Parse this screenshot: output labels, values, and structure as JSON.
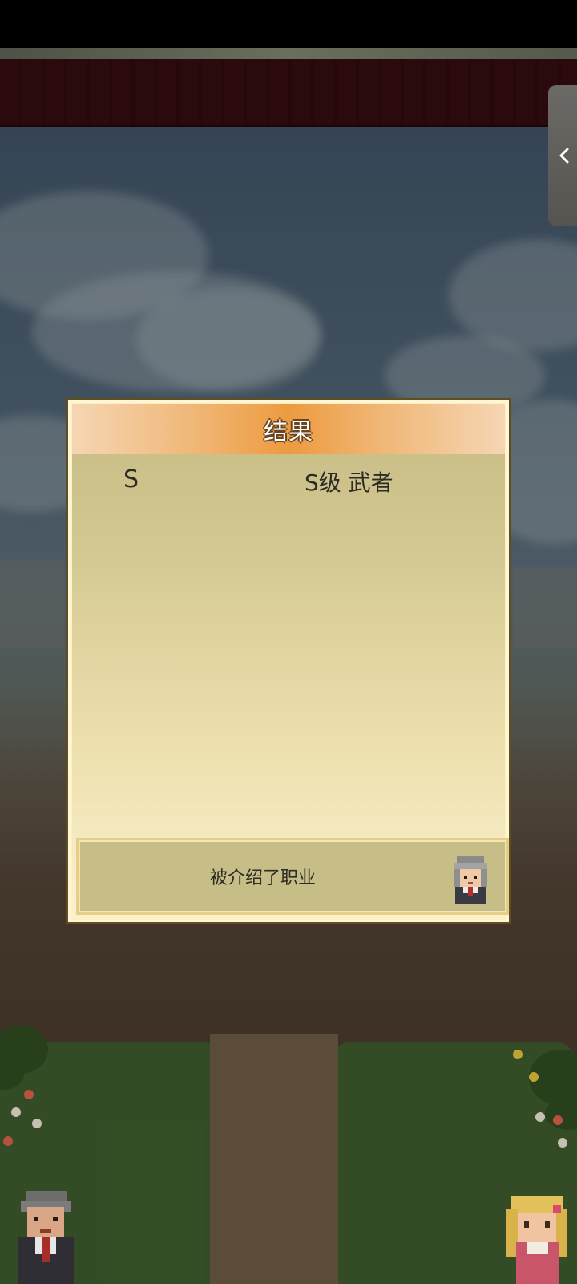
{
  "result_panel": {
    "title": "结果",
    "grade": "S",
    "job": "S级 武者",
    "message": "被介绍了职业"
  },
  "icons": {
    "side_tab": "chevron-left-icon",
    "advisor": "advisor-portrait",
    "villager_left": "elder-villager-sprite",
    "villager_right": "blonde-villager-sprite"
  },
  "colors": {
    "header_accent": "#ed9b3f",
    "panel_bg": "#ecdfac",
    "maroon_bar": "#2a0a0d"
  }
}
